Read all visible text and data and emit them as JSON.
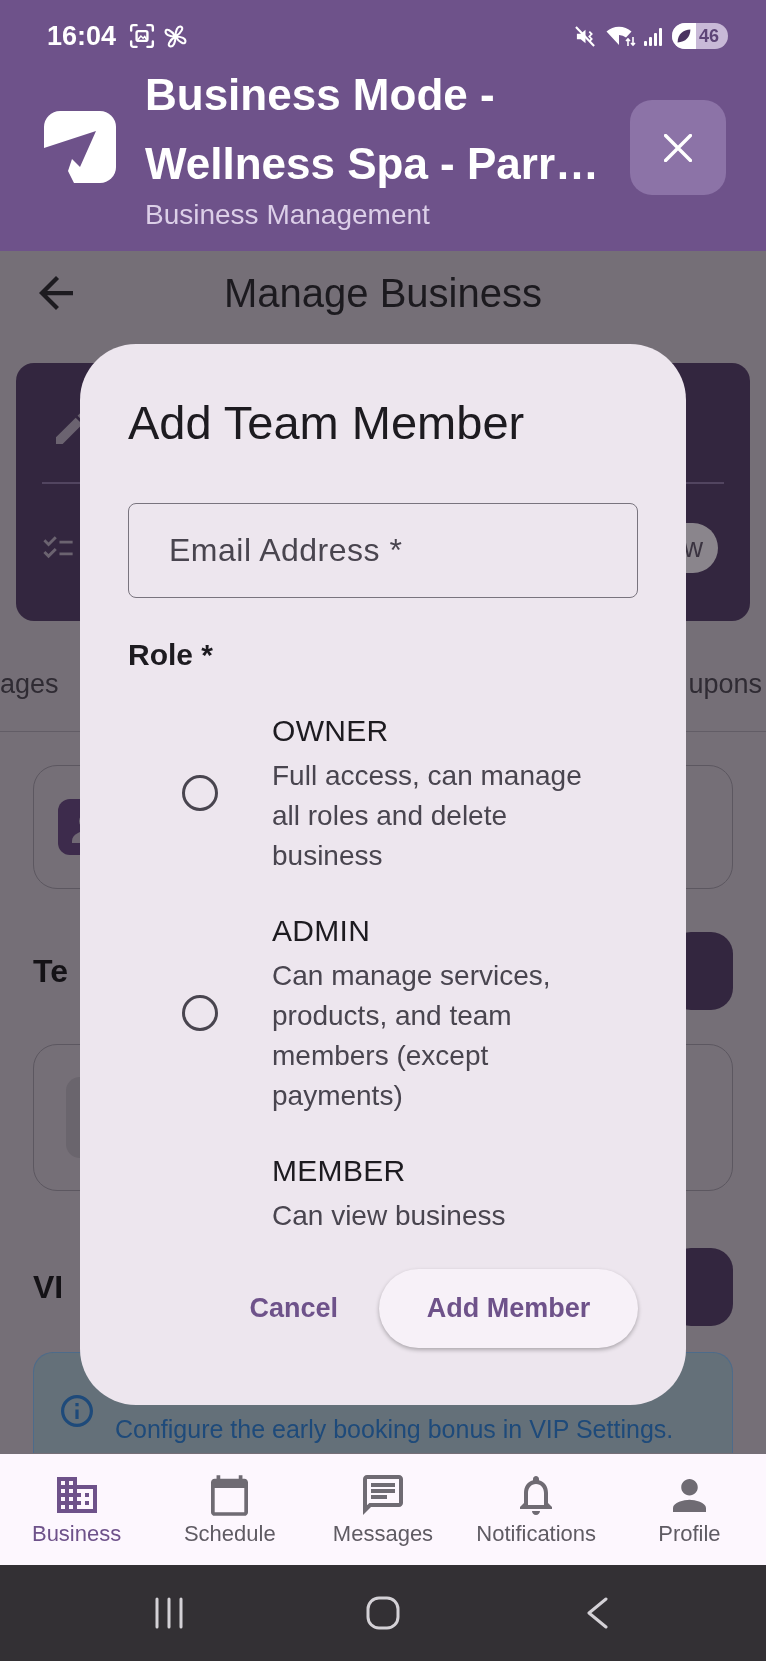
{
  "status_bar": {
    "time": "16:04",
    "battery": "46"
  },
  "header": {
    "title": "Business Mode - Wellness Spa - Parr…",
    "subtitle": "Business Management"
  },
  "page": {
    "title": "Manage Business",
    "summary_card": {
      "button": "w"
    },
    "tabs": [
      {
        "label": "ages",
        "selected": false
      },
      {
        "label": "upons",
        "selected": false
      }
    ],
    "sections": [
      {
        "title": "Te"
      },
      {
        "title": "VI"
      }
    ],
    "info_banner": {
      "text": "Configure the early booking bonus in VIP Settings."
    }
  },
  "dialog": {
    "title": "Add Team Member",
    "email": {
      "placeholder": "Email Address *"
    },
    "role_label": "Role *",
    "roles": [
      {
        "name": "OWNER",
        "description": "Full access, can manage all roles and delete business",
        "selected": false
      },
      {
        "name": "ADMIN",
        "description": "Can manage services, products, and team members (except payments)",
        "selected": false
      },
      {
        "name": "MEMBER",
        "description": "Can view business"
      }
    ],
    "actions": [
      {
        "label": "Cancel",
        "kind": "text"
      },
      {
        "label": "Add Member",
        "kind": "elevated"
      }
    ]
  },
  "bottom_nav": [
    {
      "label": "Business",
      "selected": true
    },
    {
      "label": "Schedule",
      "selected": false
    },
    {
      "label": "Messages",
      "selected": false
    },
    {
      "label": "Notifications",
      "selected": false
    },
    {
      "label": "Profile",
      "selected": false
    }
  ]
}
